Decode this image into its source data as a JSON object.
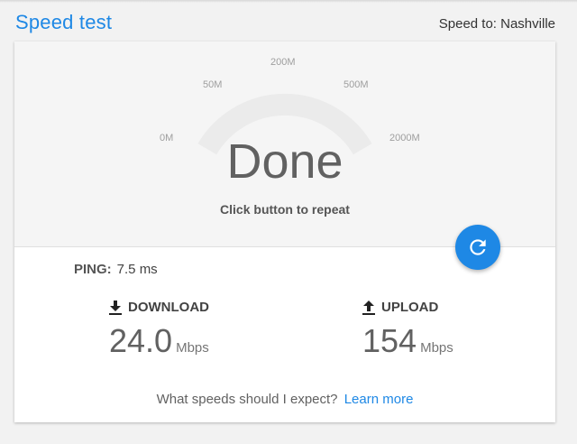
{
  "header": {
    "title": "Speed test",
    "speed_to": "Speed to: Nashville"
  },
  "gauge": {
    "ticks": [
      "0M",
      "50M",
      "200M",
      "500M",
      "2000M"
    ],
    "status": "Done",
    "hint": "Click button to repeat",
    "track_color": "#ebebeb"
  },
  "ping": {
    "label": "PING:",
    "value": "7.5 ms"
  },
  "download": {
    "label": "DOWNLOAD",
    "value": "24.0",
    "unit": "Mbps"
  },
  "upload": {
    "label": "UPLOAD",
    "value": "154",
    "unit": "Mbps"
  },
  "footer": {
    "question": "What speeds should I expect?",
    "link": "Learn more"
  },
  "colors": {
    "accent": "#1e88e5"
  }
}
